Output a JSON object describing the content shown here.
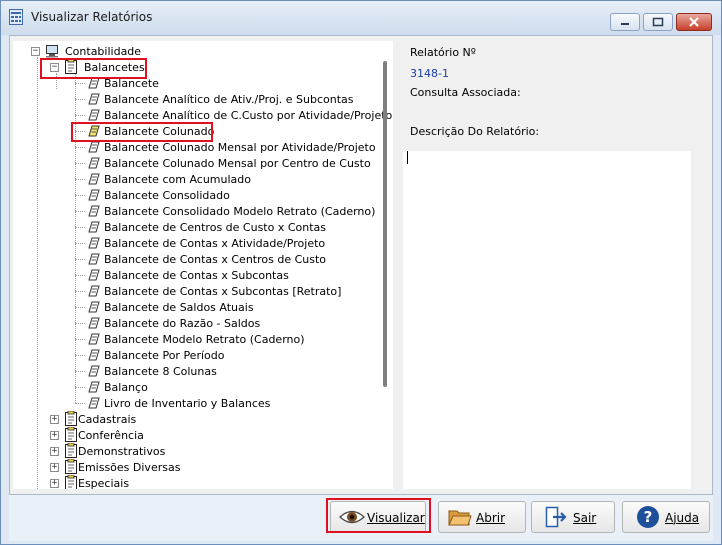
{
  "window": {
    "title": "Visualizar Relatórios"
  },
  "tree": {
    "root": {
      "label": "Contabilidade"
    },
    "group": {
      "label": "Balancetes"
    },
    "items": [
      "Balancete",
      "Balancete Analítico de Ativ./Proj. e Subcontas",
      "Balancete Analítico de C.Custo por Atividade/Projeto",
      "Balancete Colunado",
      "Balancete Colunado Mensal por Atividade/Projeto",
      "Balancete Colunado Mensal por Centro de Custo",
      "Balancete com Acumulado",
      "Balancete Consolidado",
      "Balancete Consolidado Modelo Retrato (Caderno)",
      "Balancete de Centros de Custo x Contas",
      "Balancete de Contas x Atividade/Projeto",
      "Balancete de Contas x Centros de Custo",
      "Balancete de Contas x Subcontas",
      "Balancete de Contas x Subcontas [Retrato]",
      "Balancete de Saldos Atuais",
      "Balancete do Razão - Saldos",
      "Balancete Modelo Retrato (Caderno)",
      "Balancete Por Período",
      "Balancete 8 Colunas",
      "Balanço",
      "Livro de Inventario y Balances"
    ],
    "selected_item": "Balancete Colunado",
    "other_groups": [
      "Cadastrais",
      "Conferência",
      "Demonstrativos",
      "Emissões Diversas",
      "Especiais"
    ]
  },
  "details": {
    "report_number_label": "Relatório Nº",
    "report_number_value": "3148-1",
    "associated_query_label": "Consulta Associada:",
    "description_label": "Descrição Do Relatório:"
  },
  "buttons": {
    "visualizar": "Visualizar",
    "abrir": "Abrir",
    "sair": "Sair",
    "ajuda": "Ajuda"
  },
  "colors": {
    "highlight": "#e01020",
    "value_text": "#1a3fa0"
  }
}
